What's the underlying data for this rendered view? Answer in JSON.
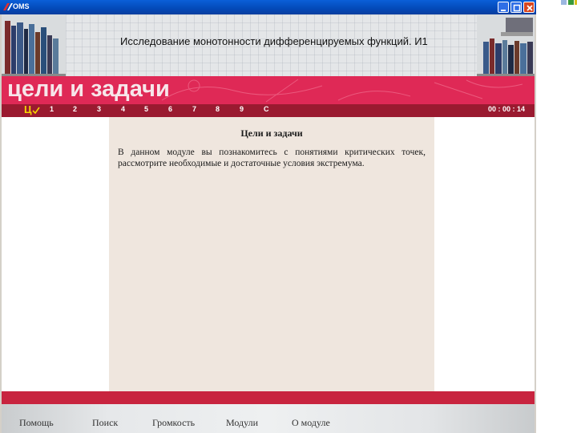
{
  "window": {
    "app_title": "OMS"
  },
  "header": {
    "module_title": "Исследование монотонности дифференцируемых функций. И1",
    "minimize_label": "_",
    "close_label": "X"
  },
  "banner": {
    "section_title": "цели и задачи"
  },
  "nav": {
    "current_label": "Ц",
    "items": [
      "1",
      "2",
      "3",
      "4",
      "5",
      "6",
      "7",
      "8",
      "9",
      "С"
    ],
    "timer": "00 : 00 : 14"
  },
  "content": {
    "heading": "Цели и задачи",
    "body": "В данном модуле вы познакомитесь с понятиями критических точек, рассмотрите необходимые и достаточные условия экстремума."
  },
  "footer": {
    "help": "Помощь",
    "search": "Поиск",
    "volume": "Громкость",
    "modules": "Модули",
    "about": "О модуле"
  },
  "colors": {
    "banner": "#df2956",
    "navbar": "#9a1a30",
    "panel": "#efe6de",
    "accent_yellow": "#f6d500"
  }
}
